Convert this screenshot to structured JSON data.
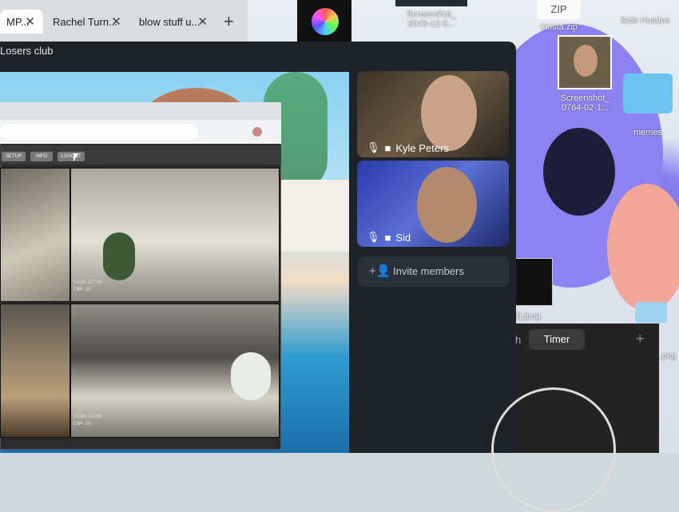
{
  "browser_tabs": [
    {
      "label": "MP...",
      "close": "✕"
    },
    {
      "label": "Rachel Turn...",
      "close": "✕"
    },
    {
      "label": "blow stuff u...",
      "close": "✕"
    }
  ],
  "new_tab_label": "+",
  "call": {
    "title": "Losers club",
    "participants": [
      {
        "name": "Kyle Peters"
      },
      {
        "name": "Sid"
      }
    ],
    "invite_label": "Invite members"
  },
  "inner_browser": {
    "toolbar_buttons": [
      "SETUP",
      "INFO",
      "LOGOUT"
    ],
    "cam_labels": [
      "2010/12/06",
      "CAM-10",
      "2010/12/06",
      "CAM-10"
    ]
  },
  "desktop": {
    "icons": [
      {
        "label": "Screenshot_\n3043-12-9..."
      },
      {
        "label": "ZIP"
      },
      {
        "label": "kinsta.zip"
      },
      {
        "label": "Side Hustles"
      },
      {
        "label": "Screenshot_\n0764-02-1..."
      },
      {
        "label": "memes"
      },
      {
        "label": "3).jpeg"
      },
      {
        "label": ".pkg"
      }
    ]
  },
  "timer": {
    "tab_partial": "h",
    "tab_active": "Timer",
    "add_label": "+"
  },
  "colors": {
    "call_bg": "#1e2328",
    "invite_bg": "#2a3038",
    "desktop_purple": "#8a7ff0"
  }
}
